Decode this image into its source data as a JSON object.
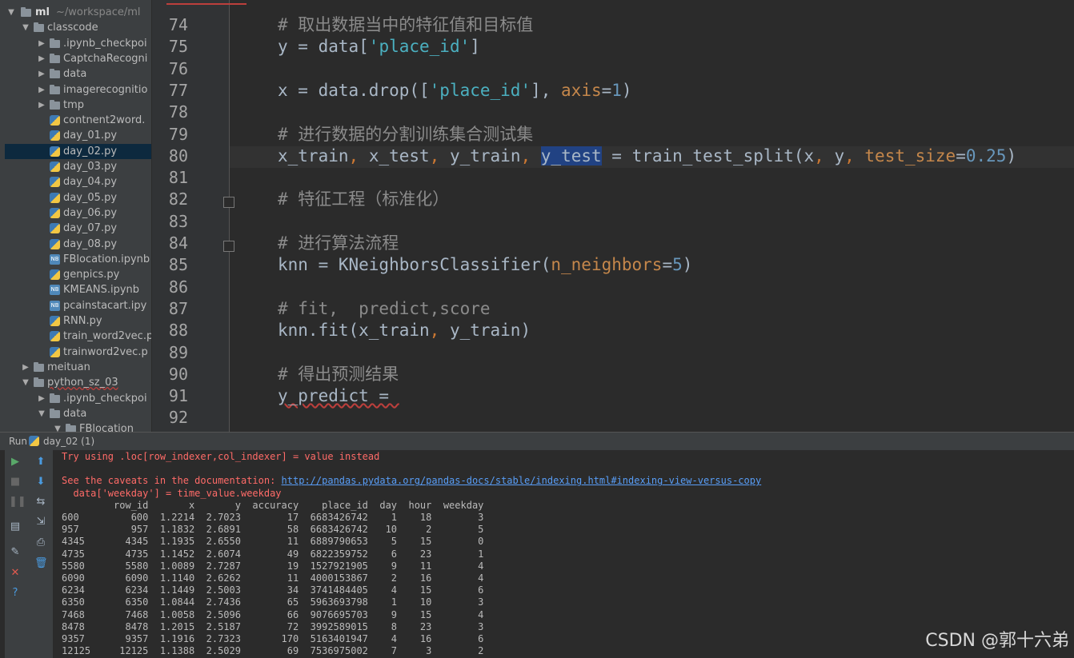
{
  "project_tree": {
    "root": {
      "name": "ml",
      "path": "~/workspace/ml"
    },
    "items": [
      {
        "label": "classcode",
        "kind": "folder",
        "depth": 1,
        "expanded": true
      },
      {
        "label": ".ipynb_checkpoi",
        "kind": "folder",
        "depth": 2,
        "expanded": false
      },
      {
        "label": "CaptchaRecogni",
        "kind": "folder",
        "depth": 2,
        "expanded": false
      },
      {
        "label": "data",
        "kind": "folder",
        "depth": 2,
        "expanded": false
      },
      {
        "label": "imagerecognitio",
        "kind": "folder",
        "depth": 2,
        "expanded": false
      },
      {
        "label": "tmp",
        "kind": "folder",
        "depth": 2,
        "expanded": false
      },
      {
        "label": "contnent2word.",
        "kind": "py",
        "depth": 2
      },
      {
        "label": "day_01.py",
        "kind": "py",
        "depth": 2
      },
      {
        "label": "day_02.py",
        "kind": "py",
        "depth": 2,
        "selected": true
      },
      {
        "label": "day_03.py",
        "kind": "py",
        "depth": 2
      },
      {
        "label": "day_04.py",
        "kind": "py",
        "depth": 2
      },
      {
        "label": "day_05.py",
        "kind": "py",
        "depth": 2
      },
      {
        "label": "day_06.py",
        "kind": "py",
        "depth": 2
      },
      {
        "label": "day_07.py",
        "kind": "py",
        "depth": 2
      },
      {
        "label": "day_08.py",
        "kind": "py",
        "depth": 2
      },
      {
        "label": "FBlocation.ipynb",
        "kind": "nb",
        "depth": 2
      },
      {
        "label": "genpics.py",
        "kind": "py",
        "depth": 2
      },
      {
        "label": "KMEANS.ipynb",
        "kind": "nb",
        "depth": 2
      },
      {
        "label": "pcainstacart.ipy",
        "kind": "nb",
        "depth": 2
      },
      {
        "label": "RNN.py",
        "kind": "py",
        "depth": 2
      },
      {
        "label": "train_word2vec.p",
        "kind": "py",
        "depth": 2
      },
      {
        "label": "trainword2vec.p",
        "kind": "py",
        "depth": 2
      },
      {
        "label": "meituan",
        "kind": "folder",
        "depth": 1,
        "expanded": false
      },
      {
        "label": "python_sz_03",
        "kind": "folder",
        "depth": 1,
        "expanded": true,
        "error": true
      },
      {
        "label": ".ipynb_checkpoi",
        "kind": "folder",
        "depth": 2,
        "expanded": false
      },
      {
        "label": "data",
        "kind": "folder",
        "depth": 2,
        "expanded": true
      },
      {
        "label": "FBlocation",
        "kind": "folder",
        "depth": 3,
        "expanded": true
      }
    ]
  },
  "editor": {
    "lines": [
      {
        "n": "74",
        "tokens": [
          {
            "t": "# 取出数据当中的特征值和目标值",
            "c": "cm"
          }
        ]
      },
      {
        "n": "75",
        "tokens": [
          {
            "t": "y = data[",
            "c": ""
          },
          {
            "t": "'place_id'",
            "c": "str2"
          },
          {
            "t": "]",
            "c": ""
          }
        ]
      },
      {
        "n": "76",
        "tokens": []
      },
      {
        "n": "77",
        "tokens": [
          {
            "t": "x = data.drop([",
            "c": ""
          },
          {
            "t": "'place_id'",
            "c": "str2"
          },
          {
            "t": "], ",
            "c": ""
          },
          {
            "t": "axis",
            "c": "kwarg"
          },
          {
            "t": "=",
            "c": ""
          },
          {
            "t": "1",
            "c": "num"
          },
          {
            "t": ")",
            "c": ""
          }
        ]
      },
      {
        "n": "78",
        "tokens": []
      },
      {
        "n": "79",
        "tokens": [
          {
            "t": "# 进行数据的分割训练集合测试集",
            "c": "cm"
          }
        ]
      },
      {
        "n": "80",
        "tokens": [
          {
            "t": "x_train",
            "c": ""
          },
          {
            "t": ", ",
            "c": "kw"
          },
          {
            "t": "x_test",
            "c": ""
          },
          {
            "t": ", ",
            "c": "kw"
          },
          {
            "t": "y_train",
            "c": ""
          },
          {
            "t": ", ",
            "c": "kw"
          },
          {
            "t": "y_test",
            "c": "sel-word"
          },
          {
            "t": " = train_test_split(x",
            "c": ""
          },
          {
            "t": ", ",
            "c": "kw"
          },
          {
            "t": "y",
            "c": ""
          },
          {
            "t": ", ",
            "c": "kw"
          },
          {
            "t": "test_size",
            "c": "kwarg"
          },
          {
            "t": "=",
            "c": ""
          },
          {
            "t": "0.25",
            "c": "num"
          },
          {
            "t": ")",
            "c": ""
          }
        ]
      },
      {
        "n": "81",
        "tokens": []
      },
      {
        "n": "82",
        "tokens": [
          {
            "t": "# 特征工程（标准化）",
            "c": "cm"
          }
        ]
      },
      {
        "n": "83",
        "tokens": []
      },
      {
        "n": "84",
        "tokens": [
          {
            "t": "# 进行算法流程",
            "c": "cm"
          }
        ]
      },
      {
        "n": "85",
        "tokens": [
          {
            "t": "knn = KNeighborsClassifier(",
            "c": ""
          },
          {
            "t": "n_neighbors",
            "c": "kwarg"
          },
          {
            "t": "=",
            "c": ""
          },
          {
            "t": "5",
            "c": "num"
          },
          {
            "t": ")",
            "c": ""
          }
        ]
      },
      {
        "n": "86",
        "tokens": []
      },
      {
        "n": "87",
        "tokens": [
          {
            "t": "# fit,  predict,score",
            "c": "cm"
          }
        ]
      },
      {
        "n": "88",
        "tokens": [
          {
            "t": "knn.fit(x_train",
            "c": ""
          },
          {
            "t": ", ",
            "c": "kw"
          },
          {
            "t": "y_train)",
            "c": ""
          }
        ]
      },
      {
        "n": "89",
        "tokens": []
      },
      {
        "n": "90",
        "tokens": [
          {
            "t": "# 得出预测结果",
            "c": "cm"
          }
        ]
      },
      {
        "n": "91",
        "tokens": [
          {
            "t": "y_predict = ",
            "c": "warn"
          }
        ]
      },
      {
        "n": "92",
        "tokens": []
      }
    ]
  },
  "run": {
    "label": "Run",
    "config": "day_02 (1)"
  },
  "console": {
    "lines": [
      {
        "text": "Try using .loc[row_indexer,col_indexer] = value instead",
        "c": "errtxt"
      },
      {
        "text": "",
        "c": ""
      },
      {
        "text": "See the caveats in the documentation: ",
        "c": "errtxt",
        "link": "http://pandas.pydata.org/pandas-docs/stable/indexing.html#indexing-view-versus-copy"
      },
      {
        "text": "  data['weekday'] = time_value.weekday",
        "c": "errtxt"
      },
      {
        "text": "         row_id       x       y  accuracy    place_id  day  hour  weekday",
        "c": ""
      },
      {
        "text": "600         600  1.2214  2.7023        17  6683426742    1    18        3",
        "c": ""
      },
      {
        "text": "957         957  1.1832  2.6891        58  6683426742   10     2        5",
        "c": ""
      },
      {
        "text": "4345       4345  1.1935  2.6550        11  6889790653    5    15        0",
        "c": ""
      },
      {
        "text": "4735       4735  1.1452  2.6074        49  6822359752    6    23        1",
        "c": ""
      },
      {
        "text": "5580       5580  1.0089  2.7287        19  1527921905    9    11        4",
        "c": ""
      },
      {
        "text": "6090       6090  1.1140  2.6262        11  4000153867    2    16        4",
        "c": ""
      },
      {
        "text": "6234       6234  1.1449  2.5003        34  3741484405    4    15        6",
        "c": ""
      },
      {
        "text": "6350       6350  1.0844  2.7436        65  5963693798    1    10        3",
        "c": ""
      },
      {
        "text": "7468       7468  1.0058  2.5096        66  9076695703    9    15        4",
        "c": ""
      },
      {
        "text": "8478       8478  1.2015  2.5187        72  3992589015    8    23        3",
        "c": ""
      },
      {
        "text": "9357       9357  1.1916  2.7323       170  5163401947    4    16        6",
        "c": ""
      },
      {
        "text": "12125     12125  1.1388  2.5029        69  7536975002    7     3        2",
        "c": ""
      }
    ]
  },
  "watermark": "CSDN @郭十六弟",
  "icons": {
    "run": "play-icon",
    "stop": "stop-icon",
    "pause": "pause-icon",
    "up": "arrow-up-icon",
    "down": "arrow-down-icon",
    "close": "close-icon",
    "help": "help-icon"
  }
}
